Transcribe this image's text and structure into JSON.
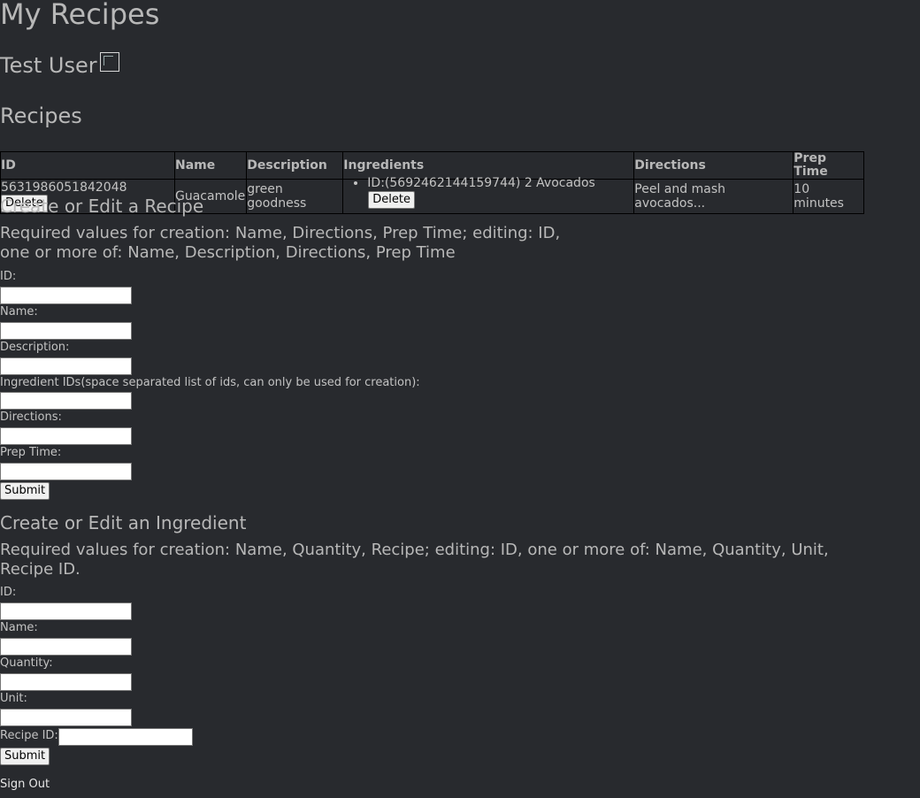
{
  "app_title": "My Recipes",
  "user": {
    "name": "Test User"
  },
  "recipes_heading": "Recipes",
  "table": {
    "headers": [
      "ID",
      "Name",
      "Description",
      "Ingredients",
      "Directions",
      "Prep Time"
    ],
    "rows": [
      {
        "id": "5631986051842048",
        "delete_label": "Delete",
        "name": "Guacamole",
        "description": "green goodness",
        "ingredients": [
          {
            "text": "ID:(5692462144159744) 2 Avocados",
            "delete_label": "Delete"
          }
        ],
        "directions": "Peel and mash avocados...",
        "prep_time": "10 minutes"
      }
    ]
  },
  "recipe_form": {
    "heading": "Create or Edit a Recipe",
    "required_note": "Required values for creation: Name, Directions, Prep Time; editing: ID, one or more of: Name, Description, Directions, Prep Time",
    "fields": {
      "id": "ID:",
      "name": "Name:",
      "description": "Description:",
      "ingredient_ids": "Ingredient IDs(space separated list of ids, can only be used for creation):",
      "directions": "Directions:",
      "prep_time": "Prep Time:"
    },
    "submit_label": "Submit"
  },
  "ingredient_form": {
    "heading": "Create or Edit an Ingredient",
    "required_note": "Required values for creation: Name, Quantity, Recipe; editing: ID, one or more of: Name, Quantity, Unit, Recipe ID.",
    "fields": {
      "id": "ID:",
      "name": "Name:",
      "quantity": "Quantity:",
      "unit": "Unit:",
      "recipe_id": "Recipe ID:"
    },
    "submit_label": "Submit"
  },
  "sign_out_label": "Sign Out",
  "colors": {
    "background": "#282a2e",
    "text": "#c3c3c3",
    "heading": "#b8b8b8"
  }
}
